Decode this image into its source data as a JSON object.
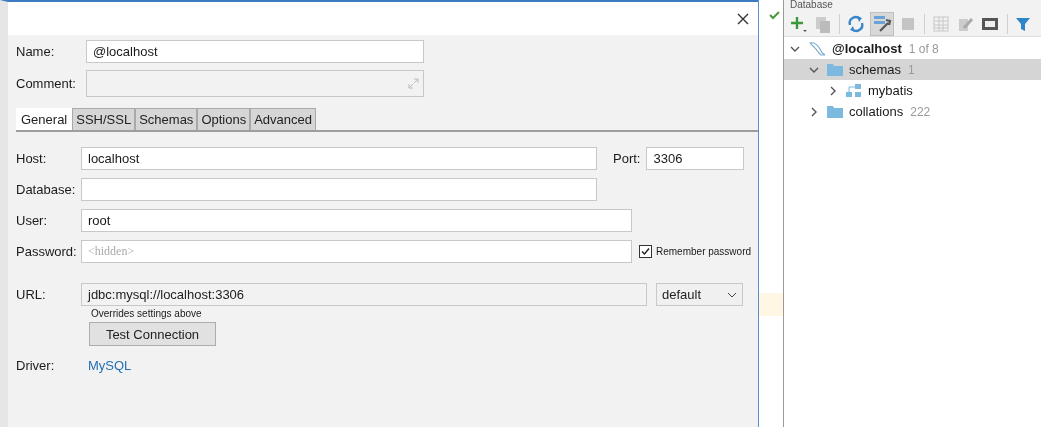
{
  "dialog": {
    "name": {
      "label": "Name:",
      "value": "@localhost"
    },
    "comment": {
      "label": "Comment:"
    },
    "tabs": [
      {
        "label": "General",
        "selected": true
      },
      {
        "label": "SSH/SSL",
        "selected": false
      },
      {
        "label": "Schemas",
        "selected": false
      },
      {
        "label": "Options",
        "selected": false
      },
      {
        "label": "Advanced",
        "selected": false
      }
    ],
    "host": {
      "label": "Host:",
      "value": "localhost"
    },
    "port": {
      "label": "Port:",
      "value": "3306"
    },
    "database": {
      "label": "Database:"
    },
    "user": {
      "label": "User:",
      "value": "root"
    },
    "password": {
      "label": "Password:",
      "placeholder": "<hidden>"
    },
    "remember_password": {
      "label": "Remember password",
      "checked": true
    },
    "url": {
      "label": "URL:",
      "value": "jdbc:mysql://localhost:3306",
      "mode": "default",
      "hint": "Overrides settings above"
    },
    "test_button": "Test Connection",
    "driver": {
      "label": "Driver:",
      "value": "MySQL"
    }
  },
  "database_panel": {
    "title": "Database",
    "tree": [
      {
        "kind": "datasource",
        "label": "@localhost",
        "count": "1 of 8",
        "expanded": true,
        "selected": false,
        "children": [
          {
            "kind": "folder",
            "label": "schemas",
            "count": "1",
            "expanded": true,
            "selected": true,
            "children": [
              {
                "kind": "schema",
                "label": "mybatis",
                "expanded": false,
                "selected": false
              }
            ]
          },
          {
            "kind": "folder",
            "label": "collations",
            "count": "222",
            "expanded": false,
            "selected": false
          }
        ]
      }
    ]
  }
}
